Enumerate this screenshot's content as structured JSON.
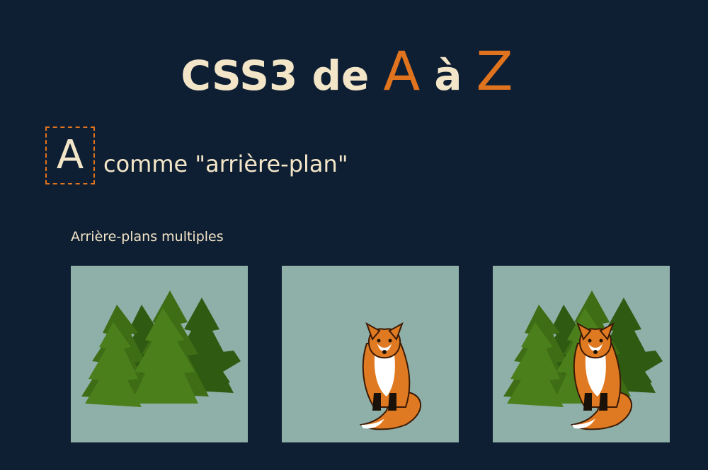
{
  "header": {
    "title_prefix": "CSS3 de",
    "letter_start": "A",
    "connector": "à",
    "letter_end": "Z"
  },
  "section": {
    "letter": "A",
    "text": "comme \"arrière-plan\""
  },
  "demo": {
    "subtitle": "Arrière-plans multiples",
    "panels": [
      {
        "content": "forest-trees"
      },
      {
        "content": "fox"
      },
      {
        "content": "forest-trees-and-fox"
      }
    ]
  },
  "colors": {
    "background": "#0f1f33",
    "accent": "#e0731e",
    "text": "#f3e6c8",
    "panel": "#8fb0a9"
  }
}
